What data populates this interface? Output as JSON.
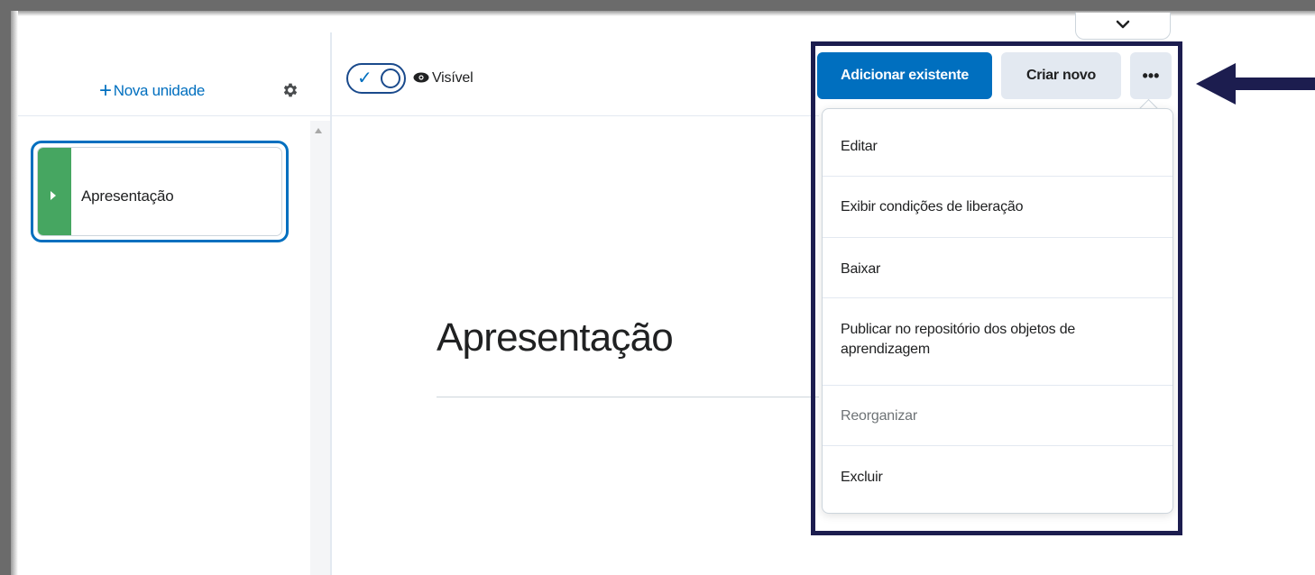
{
  "sidebar": {
    "new_unit_label": "Nova unidade",
    "new_unit_icon": "plus-icon",
    "settings_icon": "gear-icon",
    "units": [
      {
        "label": "Apresentação",
        "color": "#46a661"
      }
    ]
  },
  "header": {
    "visibility_label": "Visível",
    "visibility_on": true
  },
  "main": {
    "title": "Apresentação"
  },
  "actions": {
    "add_existing_label": "Adicionar existente",
    "create_new_label": "Criar novo",
    "more_label": "•••"
  },
  "menu": {
    "items": [
      {
        "label": "Editar",
        "enabled": true
      },
      {
        "label": "Exibir condições de liberação",
        "enabled": true
      },
      {
        "label": "Baixar",
        "enabled": true
      },
      {
        "label": "Publicar no repositório dos objetos de aprendizagem",
        "enabled": true
      },
      {
        "label": "Reorganizar",
        "enabled": false
      },
      {
        "label": "Excluir",
        "enabled": true
      }
    ]
  },
  "colors": {
    "accent": "#006fbf",
    "unit_green": "#46a661",
    "highlight": "#1c1d4f"
  }
}
